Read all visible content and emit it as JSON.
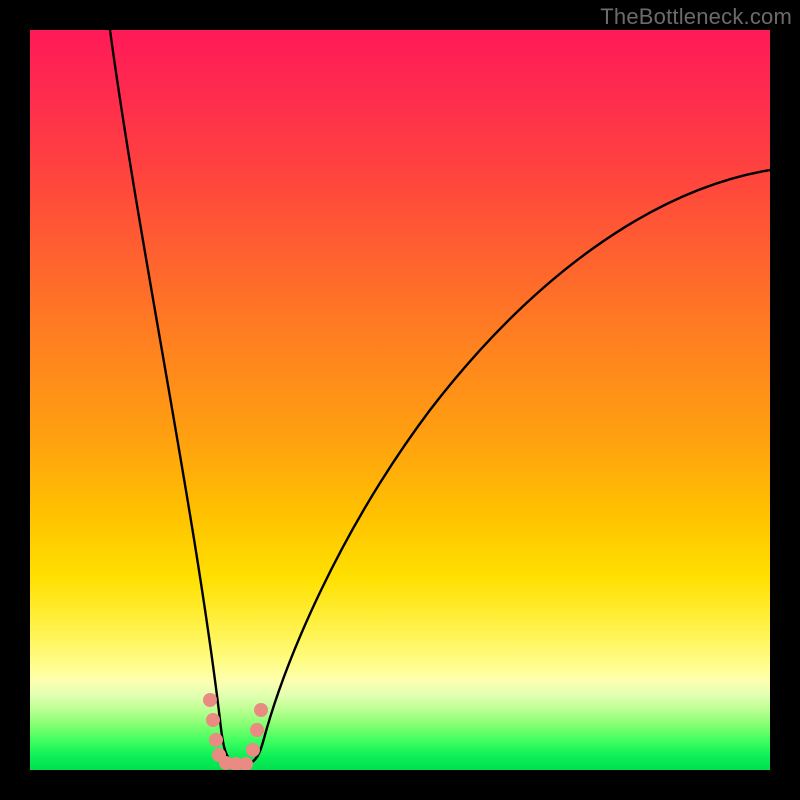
{
  "watermark": "TheBottleneck.com",
  "chart_data": {
    "type": "line",
    "title": "",
    "xlabel": "",
    "ylabel": "",
    "xlim": [
      0,
      100
    ],
    "ylim": [
      0,
      100
    ],
    "note": "No axes, ticks, or numeric labels are rendered in the image; values are estimated in 0–100 plot-area percent coordinates from pixel positions.",
    "series": [
      {
        "name": "left-arm",
        "x": [
          10.8,
          12.8,
          15.5,
          18.2,
          20.3,
          23.0,
          24.3,
          25.3,
          25.7
        ],
        "y": [
          100,
          82.4,
          62.2,
          43.2,
          29.7,
          12.2,
          4.1,
          1.4,
          0.7
        ]
      },
      {
        "name": "right-arm",
        "x": [
          29.7,
          31.1,
          33.8,
          37.8,
          43.2,
          50.0,
          58.1,
          66.2,
          74.3,
          83.8,
          91.9,
          100
        ],
        "y": [
          0.7,
          4.1,
          12.2,
          23.0,
          35.1,
          47.3,
          58.1,
          66.2,
          71.6,
          76.4,
          79.1,
          81.1
        ]
      },
      {
        "name": "valley-floor",
        "x": [
          25.7,
          27.0,
          28.4,
          29.7
        ],
        "y": [
          0.7,
          0.5,
          0.5,
          0.7
        ]
      }
    ],
    "markers": [
      {
        "x": 24.3,
        "y": 9.5
      },
      {
        "x": 24.7,
        "y": 6.8
      },
      {
        "x": 25.0,
        "y": 4.1
      },
      {
        "x": 25.4,
        "y": 2.0
      },
      {
        "x": 26.4,
        "y": 1.0
      },
      {
        "x": 27.7,
        "y": 0.8
      },
      {
        "x": 29.1,
        "y": 0.8
      },
      {
        "x": 30.1,
        "y": 2.7
      },
      {
        "x": 30.7,
        "y": 5.4
      },
      {
        "x": 31.1,
        "y": 8.1
      }
    ],
    "gradient_bands_pct": {
      "red": 0,
      "orange": 45,
      "yellow": 78,
      "pale_yellow": 87,
      "green": 93
    }
  }
}
